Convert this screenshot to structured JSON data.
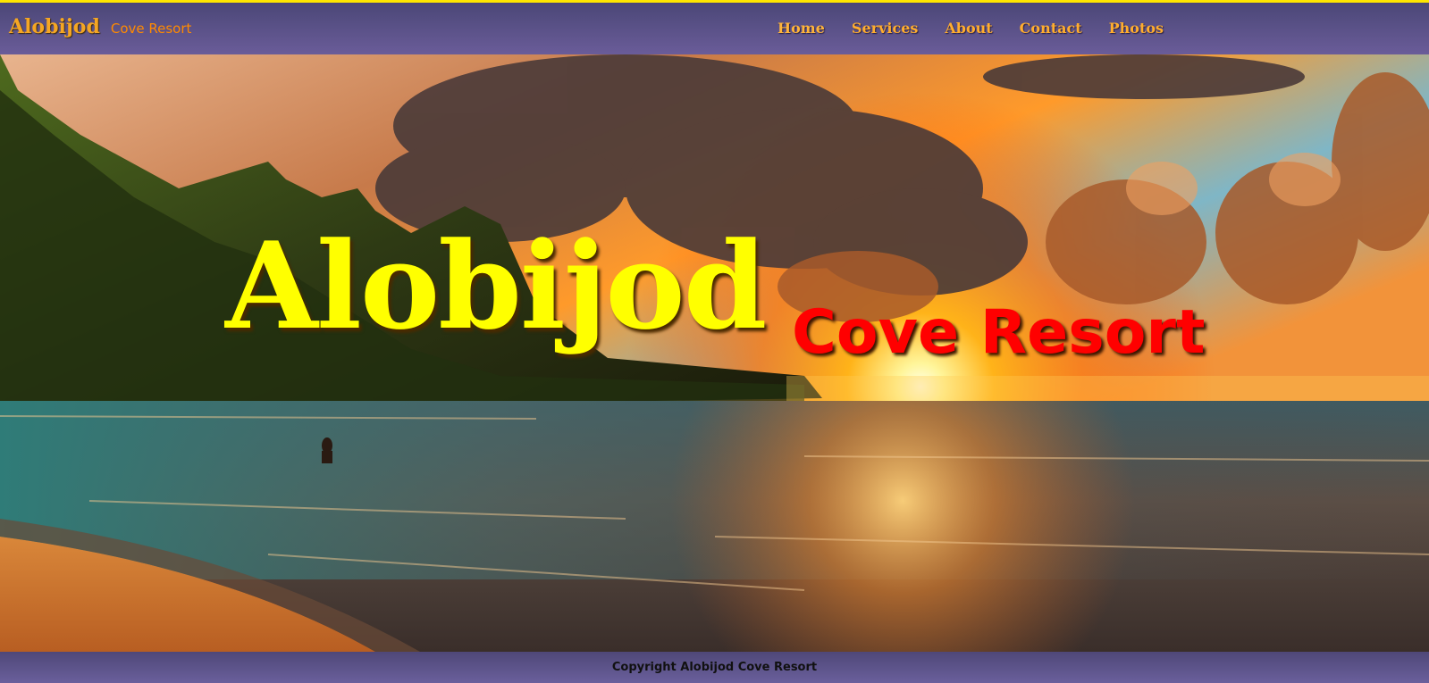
{
  "header": {
    "brand_main": "Alobijod",
    "brand_sub": "Cove Resort"
  },
  "nav": {
    "items": [
      {
        "label": "Home"
      },
      {
        "label": "Services"
      },
      {
        "label": "About"
      },
      {
        "label": "Contact"
      },
      {
        "label": "Photos"
      }
    ]
  },
  "hero": {
    "title": "Alobijod",
    "subtitle": "Cove Resort",
    "image_description_icon": "sunset-beach-photo"
  },
  "footer": {
    "copyright": "Copyright Alobijod Cove Resort"
  },
  "colors": {
    "accent_yellow": "#ffff00",
    "accent_red": "#ff0000",
    "nav_orange": "#ffad2e",
    "bar_purple": "#5e5488"
  }
}
